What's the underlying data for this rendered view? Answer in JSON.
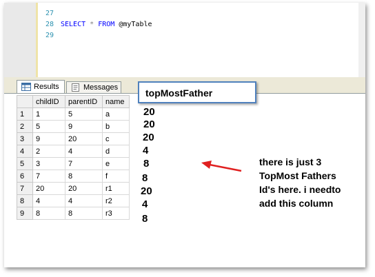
{
  "editor": {
    "lines": [
      {
        "num": "27",
        "text": ""
      },
      {
        "num": "28",
        "text": "SELECT * FROM @myTable"
      },
      {
        "num": "29",
        "text": ""
      }
    ],
    "code": {
      "select": "SELECT",
      "star": "*",
      "from": "FROM",
      "table": "@myTable"
    }
  },
  "tabs": {
    "results": "Results",
    "messages": "Messages"
  },
  "grid": {
    "columns": [
      "childID",
      "parentID",
      "name"
    ],
    "rows": [
      {
        "rn": "1",
        "childID": "1",
        "parentID": "5",
        "name": "a"
      },
      {
        "rn": "2",
        "childID": "5",
        "parentID": "9",
        "name": "b"
      },
      {
        "rn": "3",
        "childID": "9",
        "parentID": "20",
        "name": "c"
      },
      {
        "rn": "4",
        "childID": "2",
        "parentID": "4",
        "name": "d"
      },
      {
        "rn": "5",
        "childID": "3",
        "parentID": "7",
        "name": "e"
      },
      {
        "rn": "6",
        "childID": "7",
        "parentID": "8",
        "name": "f"
      },
      {
        "rn": "7",
        "childID": "20",
        "parentID": "20",
        "name": "r1"
      },
      {
        "rn": "8",
        "childID": "4",
        "parentID": "4",
        "name": "r2"
      },
      {
        "rn": "9",
        "childID": "8",
        "parentID": "8",
        "name": "r3"
      }
    ]
  },
  "annotation": {
    "header": "topMostFather",
    "values": [
      "20",
      "20",
      "20",
      "4",
      "8",
      "8",
      "20",
      "4",
      "8"
    ],
    "note": "there is just 3 TopMost Fathers Id's here. i needto add this column",
    "colors": {
      "arrow": "#e02020",
      "callout_border": "#4f81bd"
    }
  }
}
